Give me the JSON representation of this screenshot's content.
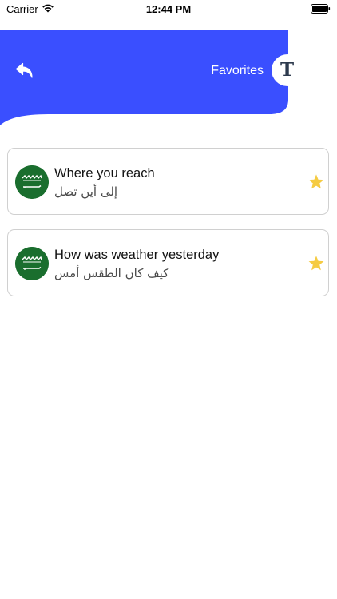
{
  "status_bar": {
    "carrier": "Carrier",
    "time": "12:44 PM",
    "wifi_icon": "wifi-icon",
    "battery_icon": "battery-icon"
  },
  "header": {
    "title": "Favorites",
    "back_icon": "back-arrow-icon",
    "translate_glyph": "T",
    "accent_color": "#3a4fff"
  },
  "favorites": [
    {
      "english": "Where you reach",
      "arabic": "إلى أين تصل",
      "flag_icon": "saudi-arabia-flag-icon",
      "star_icon": "star-icon"
    },
    {
      "english": "How was weather yesterday",
      "arabic": "كيف كان الطقس أمس",
      "flag_icon": "saudi-arabia-flag-icon",
      "star_icon": "star-icon"
    }
  ],
  "colors": {
    "star": "#f5cb42",
    "flag_green": "#1a6e2e",
    "card_border": "#d0d0d0"
  }
}
